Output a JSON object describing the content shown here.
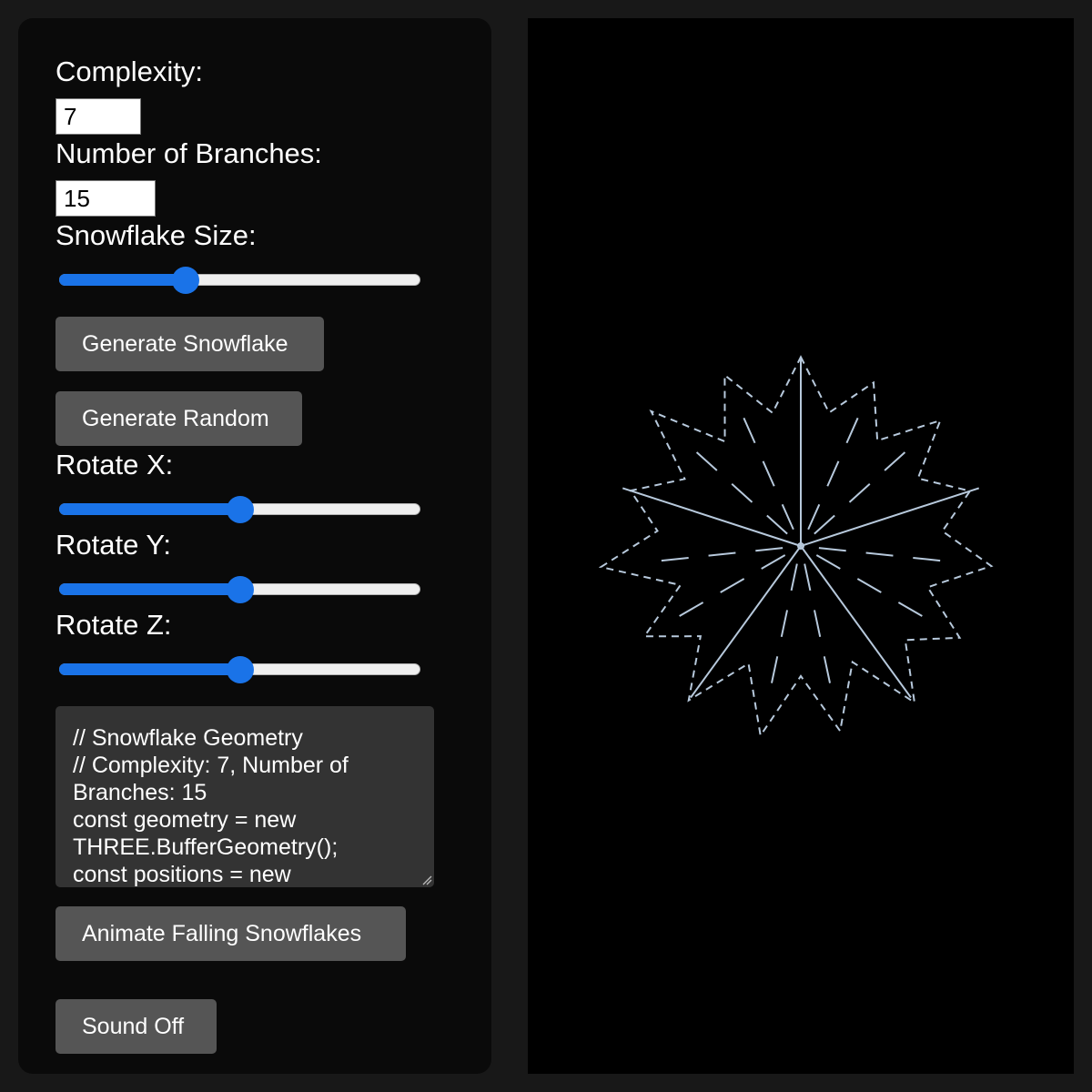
{
  "controls": {
    "complexity": {
      "label": "Complexity:",
      "value": "7"
    },
    "branches": {
      "label": "Number of Branches:",
      "value": "15"
    },
    "size": {
      "label": "Snowflake Size:",
      "value": 0.35
    },
    "generate_label": "Generate Snowflake",
    "random_label": "Generate Random",
    "rotate_x": {
      "label": "Rotate X:",
      "value": 0.5
    },
    "rotate_y": {
      "label": "Rotate Y:",
      "value": 0.5
    },
    "rotate_z": {
      "label": "Rotate Z:",
      "value": 0.5
    },
    "code_text": "// Snowflake Geometry\n// Complexity: 7, Number of Branches: 15\nconst geometry = new THREE.BufferGeometry();\nconst positions = new",
    "animate_label": "Animate Falling Snowflakes",
    "sound_label": "Sound Off"
  },
  "snowflake": {
    "branches": 15,
    "complexity": 7,
    "color": "#b7c9dc"
  },
  "colors": {
    "accent": "#1a73e8",
    "button": "#555555",
    "panel": "#0a0a0a"
  }
}
